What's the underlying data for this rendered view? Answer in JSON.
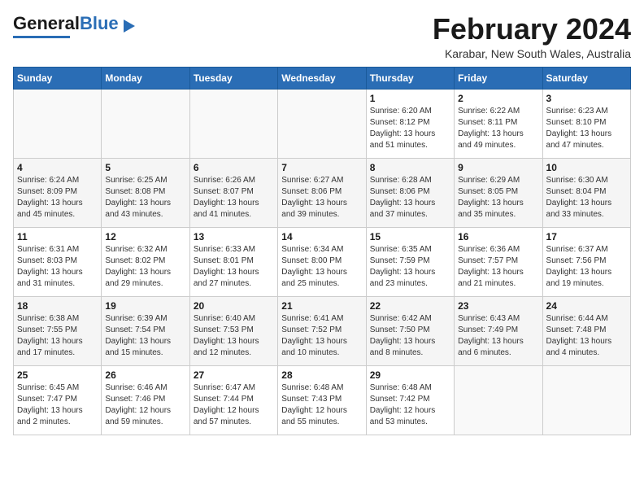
{
  "app": {
    "logo_general": "General",
    "logo_blue": "Blue"
  },
  "header": {
    "month": "February 2024",
    "location": "Karabar, New South Wales, Australia"
  },
  "weekdays": [
    "Sunday",
    "Monday",
    "Tuesday",
    "Wednesday",
    "Thursday",
    "Friday",
    "Saturday"
  ],
  "weeks": [
    [
      {
        "day": "",
        "info": ""
      },
      {
        "day": "",
        "info": ""
      },
      {
        "day": "",
        "info": ""
      },
      {
        "day": "",
        "info": ""
      },
      {
        "day": "1",
        "info": "Sunrise: 6:20 AM\nSunset: 8:12 PM\nDaylight: 13 hours\nand 51 minutes."
      },
      {
        "day": "2",
        "info": "Sunrise: 6:22 AM\nSunset: 8:11 PM\nDaylight: 13 hours\nand 49 minutes."
      },
      {
        "day": "3",
        "info": "Sunrise: 6:23 AM\nSunset: 8:10 PM\nDaylight: 13 hours\nand 47 minutes."
      }
    ],
    [
      {
        "day": "4",
        "info": "Sunrise: 6:24 AM\nSunset: 8:09 PM\nDaylight: 13 hours\nand 45 minutes."
      },
      {
        "day": "5",
        "info": "Sunrise: 6:25 AM\nSunset: 8:08 PM\nDaylight: 13 hours\nand 43 minutes."
      },
      {
        "day": "6",
        "info": "Sunrise: 6:26 AM\nSunset: 8:07 PM\nDaylight: 13 hours\nand 41 minutes."
      },
      {
        "day": "7",
        "info": "Sunrise: 6:27 AM\nSunset: 8:06 PM\nDaylight: 13 hours\nand 39 minutes."
      },
      {
        "day": "8",
        "info": "Sunrise: 6:28 AM\nSunset: 8:06 PM\nDaylight: 13 hours\nand 37 minutes."
      },
      {
        "day": "9",
        "info": "Sunrise: 6:29 AM\nSunset: 8:05 PM\nDaylight: 13 hours\nand 35 minutes."
      },
      {
        "day": "10",
        "info": "Sunrise: 6:30 AM\nSunset: 8:04 PM\nDaylight: 13 hours\nand 33 minutes."
      }
    ],
    [
      {
        "day": "11",
        "info": "Sunrise: 6:31 AM\nSunset: 8:03 PM\nDaylight: 13 hours\nand 31 minutes."
      },
      {
        "day": "12",
        "info": "Sunrise: 6:32 AM\nSunset: 8:02 PM\nDaylight: 13 hours\nand 29 minutes."
      },
      {
        "day": "13",
        "info": "Sunrise: 6:33 AM\nSunset: 8:01 PM\nDaylight: 13 hours\nand 27 minutes."
      },
      {
        "day": "14",
        "info": "Sunrise: 6:34 AM\nSunset: 8:00 PM\nDaylight: 13 hours\nand 25 minutes."
      },
      {
        "day": "15",
        "info": "Sunrise: 6:35 AM\nSunset: 7:59 PM\nDaylight: 13 hours\nand 23 minutes."
      },
      {
        "day": "16",
        "info": "Sunrise: 6:36 AM\nSunset: 7:57 PM\nDaylight: 13 hours\nand 21 minutes."
      },
      {
        "day": "17",
        "info": "Sunrise: 6:37 AM\nSunset: 7:56 PM\nDaylight: 13 hours\nand 19 minutes."
      }
    ],
    [
      {
        "day": "18",
        "info": "Sunrise: 6:38 AM\nSunset: 7:55 PM\nDaylight: 13 hours\nand 17 minutes."
      },
      {
        "day": "19",
        "info": "Sunrise: 6:39 AM\nSunset: 7:54 PM\nDaylight: 13 hours\nand 15 minutes."
      },
      {
        "day": "20",
        "info": "Sunrise: 6:40 AM\nSunset: 7:53 PM\nDaylight: 13 hours\nand 12 minutes."
      },
      {
        "day": "21",
        "info": "Sunrise: 6:41 AM\nSunset: 7:52 PM\nDaylight: 13 hours\nand 10 minutes."
      },
      {
        "day": "22",
        "info": "Sunrise: 6:42 AM\nSunset: 7:50 PM\nDaylight: 13 hours\nand 8 minutes."
      },
      {
        "day": "23",
        "info": "Sunrise: 6:43 AM\nSunset: 7:49 PM\nDaylight: 13 hours\nand 6 minutes."
      },
      {
        "day": "24",
        "info": "Sunrise: 6:44 AM\nSunset: 7:48 PM\nDaylight: 13 hours\nand 4 minutes."
      }
    ],
    [
      {
        "day": "25",
        "info": "Sunrise: 6:45 AM\nSunset: 7:47 PM\nDaylight: 13 hours\nand 2 minutes."
      },
      {
        "day": "26",
        "info": "Sunrise: 6:46 AM\nSunset: 7:46 PM\nDaylight: 12 hours\nand 59 minutes."
      },
      {
        "day": "27",
        "info": "Sunrise: 6:47 AM\nSunset: 7:44 PM\nDaylight: 12 hours\nand 57 minutes."
      },
      {
        "day": "28",
        "info": "Sunrise: 6:48 AM\nSunset: 7:43 PM\nDaylight: 12 hours\nand 55 minutes."
      },
      {
        "day": "29",
        "info": "Sunrise: 6:48 AM\nSunset: 7:42 PM\nDaylight: 12 hours\nand 53 minutes."
      },
      {
        "day": "",
        "info": ""
      },
      {
        "day": "",
        "info": ""
      }
    ]
  ]
}
